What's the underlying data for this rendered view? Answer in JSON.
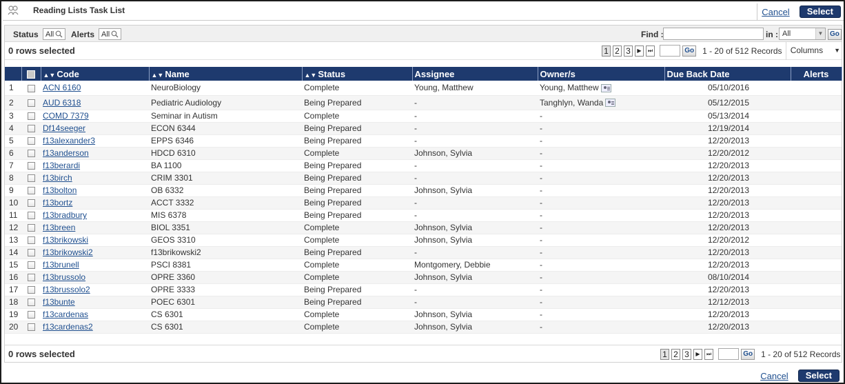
{
  "title": "Reading Lists Task List",
  "actions": {
    "cancel": "Cancel",
    "select": "Select"
  },
  "filters": {
    "status_label": "Status",
    "status_value": "All",
    "alerts_label": "Alerts",
    "alerts_value": "All",
    "find_label": "Find :",
    "in_label": "in :",
    "in_value": "All",
    "go": "Go"
  },
  "selection": {
    "rows_selected": "0 rows selected"
  },
  "pagination": {
    "pages": [
      "1",
      "2",
      "3"
    ],
    "next": "▶",
    "last": "⏭",
    "go": "Go",
    "records": "1 - 20 of 512 Records",
    "columns": "Columns"
  },
  "columns": {
    "code": "Code",
    "name": "Name",
    "status": "Status",
    "assignee": "Assignee",
    "owners": "Owner/s",
    "due": "Due Back Date",
    "alerts": "Alerts"
  },
  "rows": [
    {
      "n": "1",
      "code": "ACN 6160",
      "name": "NeuroBiology",
      "status": "Complete",
      "assignee": "Young, Matthew",
      "owner": "Young, Matthew",
      "owner_icon": true,
      "due": "05/10/2016"
    },
    {
      "n": "2",
      "code": "AUD 6318",
      "name": "Pediatric Audiology",
      "status": "Being Prepared",
      "assignee": "-",
      "owner": "Tanghlyn, Wanda",
      "owner_icon": true,
      "due": "05/12/2015"
    },
    {
      "n": "3",
      "code": "COMD 7379",
      "name": "Seminar in Autism",
      "status": "Complete",
      "assignee": "-",
      "owner": "-",
      "due": "05/13/2014"
    },
    {
      "n": "4",
      "code": "Df14seeger",
      "name": "ECON 6344",
      "status": "Being Prepared",
      "assignee": "-",
      "owner": "-",
      "due": "12/19/2014"
    },
    {
      "n": "5",
      "code": "f13alexander3",
      "name": "EPPS 6346",
      "status": "Being Prepared",
      "assignee": "-",
      "owner": "-",
      "due": "12/20/2013"
    },
    {
      "n": "6",
      "code": "f13anderson",
      "name": "HDCD 6310",
      "status": "Complete",
      "assignee": "Johnson, Sylvia",
      "owner": "-",
      "due": "12/20/2012"
    },
    {
      "n": "7",
      "code": "f13berardi",
      "name": "BA 1100",
      "status": "Being Prepared",
      "assignee": "-",
      "owner": "-",
      "due": "12/20/2013"
    },
    {
      "n": "8",
      "code": "f13birch",
      "name": "CRIM 3301",
      "status": "Being Prepared",
      "assignee": "-",
      "owner": "-",
      "due": "12/20/2013"
    },
    {
      "n": "9",
      "code": "f13bolton",
      "name": "OB 6332",
      "status": "Being Prepared",
      "assignee": "Johnson, Sylvia",
      "owner": "-",
      "due": "12/20/2013"
    },
    {
      "n": "10",
      "code": "f13bortz",
      "name": "ACCT 3332",
      "status": "Being Prepared",
      "assignee": "-",
      "owner": "-",
      "due": "12/20/2013"
    },
    {
      "n": "11",
      "code": "f13bradbury",
      "name": "MIS 6378",
      "status": "Being Prepared",
      "assignee": "-",
      "owner": "-",
      "due": "12/20/2013"
    },
    {
      "n": "12",
      "code": "f13breen",
      "name": "BIOL 3351",
      "status": "Complete",
      "assignee": "Johnson, Sylvia",
      "owner": "-",
      "due": "12/20/2013"
    },
    {
      "n": "13",
      "code": "f13brikowski",
      "name": "GEOS 3310",
      "status": "Complete",
      "assignee": "Johnson, Sylvia",
      "owner": "-",
      "due": "12/20/2012"
    },
    {
      "n": "14",
      "code": "f13brikowski2",
      "name": "f13brikowski2",
      "status": "Being Prepared",
      "assignee": "-",
      "owner": "-",
      "due": "12/20/2013"
    },
    {
      "n": "15",
      "code": "f13brunell",
      "name": "PSCI 8381",
      "status": "Complete",
      "assignee": "Montgomery, Debbie",
      "owner": "-",
      "due": "12/20/2013"
    },
    {
      "n": "16",
      "code": "f13brussolo",
      "name": "OPRE 3360",
      "status": "Complete",
      "assignee": "Johnson, Sylvia",
      "owner": "-",
      "due": "08/10/2014"
    },
    {
      "n": "17",
      "code": "f13brussolo2",
      "name": "OPRE 3333",
      "status": "Being Prepared",
      "assignee": "-",
      "owner": "-",
      "due": "12/20/2013"
    },
    {
      "n": "18",
      "code": "f13bunte",
      "name": "POEC 6301",
      "status": "Being Prepared",
      "assignee": "-",
      "owner": "-",
      "due": "12/12/2013"
    },
    {
      "n": "19",
      "code": "f13cardenas",
      "name": "CS 6301",
      "status": "Complete",
      "assignee": "Johnson, Sylvia",
      "owner": "-",
      "due": "12/20/2013"
    },
    {
      "n": "20",
      "code": "f13cardenas2",
      "name": "CS 6301",
      "status": "Complete",
      "assignee": "Johnson, Sylvia",
      "owner": "-",
      "due": "12/20/2013"
    }
  ]
}
